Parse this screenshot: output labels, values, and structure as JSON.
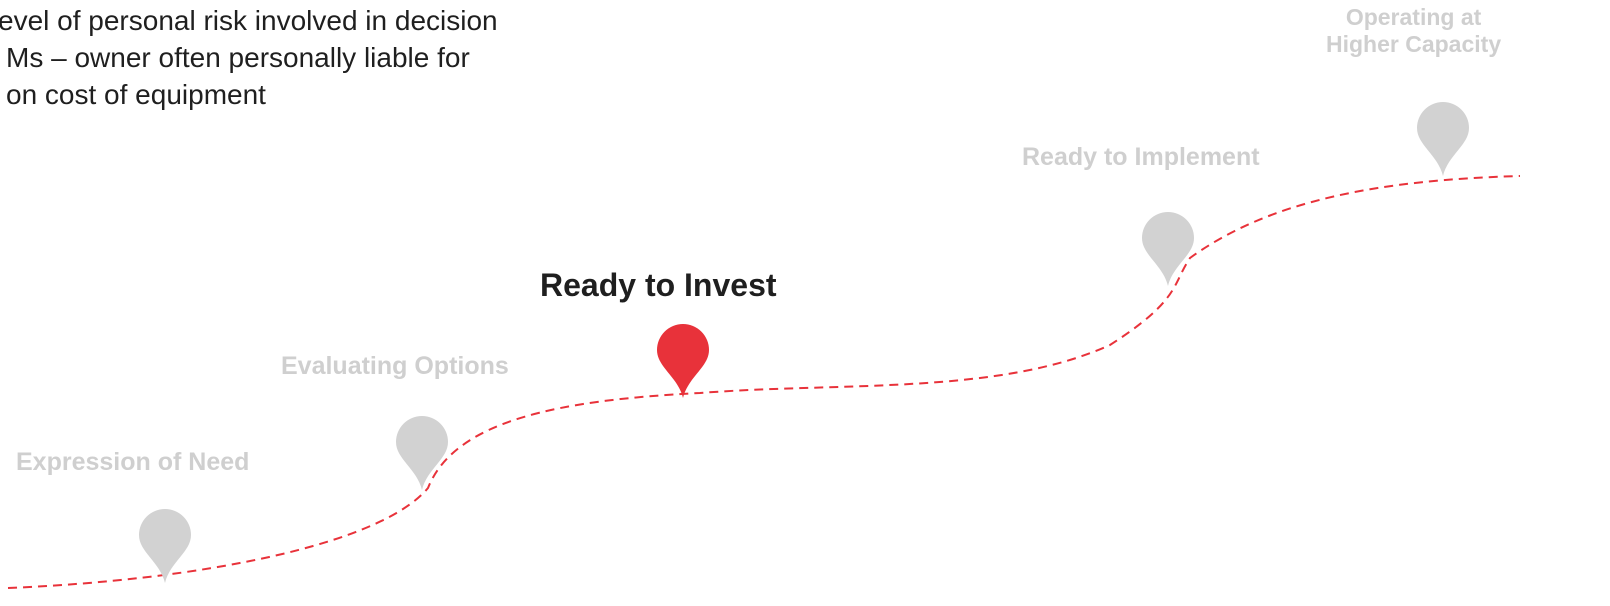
{
  "intro_text": {
    "line1": "evel of personal risk involved in decision",
    "line2": "Ms – owner often personally liable for",
    "line3": "on cost of equipment"
  },
  "colors": {
    "path": "#e8323a",
    "active_pin": "#e8323a",
    "inactive_pin": "#d2d2d2",
    "inactive_label": "#cfcfcf",
    "active_label": "#1f1f1f"
  },
  "stages": [
    {
      "label": "Expression of Need",
      "active": false,
      "icon": "map-pin-icon"
    },
    {
      "label": "Evaluating Options",
      "active": false,
      "icon": "map-pin-icon"
    },
    {
      "label": "Ready to Invest",
      "active": true,
      "icon": "map-pin-icon"
    },
    {
      "label": "Ready to Implement",
      "active": false,
      "icon": "map-pin-icon"
    },
    {
      "label_line1": "Operating at",
      "label_line2": "Higher Capacity",
      "active": false,
      "icon": "map-pin-icon"
    }
  ]
}
